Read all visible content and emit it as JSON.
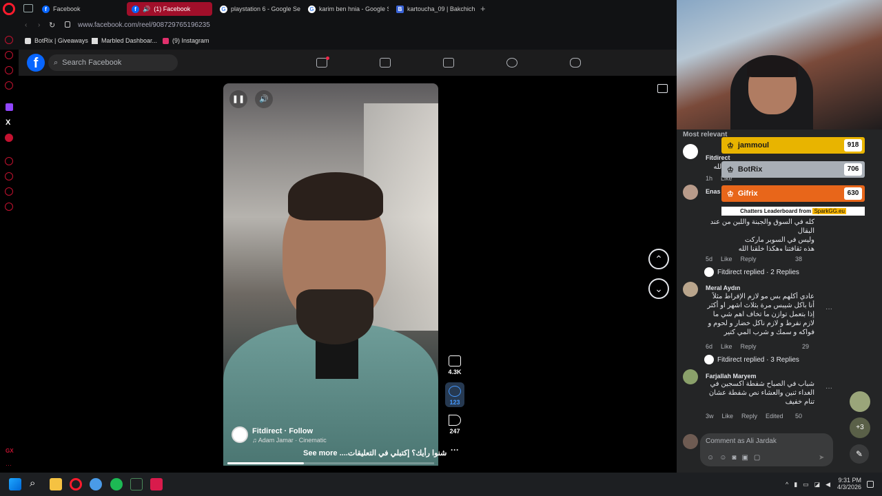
{
  "browser": {
    "tabs": [
      {
        "label": "Facebook",
        "active": false
      },
      {
        "label": "(1) Facebook",
        "active": true
      },
      {
        "label": "playstation 6 - Google Se",
        "active": false
      },
      {
        "label": "karim ben hnia - Google S",
        "active": false
      },
      {
        "label": "kartoucha_09 | Bakchich p",
        "active": false
      }
    ],
    "new_tab_label": "+",
    "url": "www.facebook.com/reel/908729765196235",
    "bookmarks": [
      "BotRix | Giveaways",
      "Marbled Dashboar...",
      "(9) Instagram"
    ]
  },
  "facebook": {
    "logo": "f",
    "search_placeholder": "Search Facebook",
    "nav": [
      "home-icon",
      "video-icon",
      "marketplace-icon",
      "groups-icon",
      "gaming-icon"
    ]
  },
  "reel": {
    "poster_name": "Fitdirect",
    "follow_label": "Follow",
    "audio": "Adam Jamar · Cinematic",
    "caption": "شنوا رأيك؟ إكتبلي في التعليقات....",
    "see_more": "See more",
    "likes": "4.3K",
    "comments": "123",
    "shares": "247",
    "more": "···",
    "progress": 0.37
  },
  "comments_panel": {
    "sort_label": "Most relevant",
    "leaderboard": [
      {
        "name": "jammoul",
        "score": "918",
        "color": "#e8b400"
      },
      {
        "name": "BotRix",
        "score": "706",
        "color": "#a9afb6"
      },
      {
        "name": "Gifrix",
        "score": "630",
        "color": "#e8661a"
      }
    ],
    "leaderboard_caption": "Chatters Leaderboard from",
    "leaderboard_brand": "SparkGG.eu",
    "items": [
      {
        "name": "Fitdirect",
        "text": "عد الله",
        "time": "1h",
        "like": "Like"
      },
      {
        "name": "Enas",
        "text": "كله في السوق والجبنة واللبن من عند البقال\nوليس في السوبر ماركت\nهذه ثقافتنا وهكذا خلقنا الله",
        "time": "5d",
        "like": "Like",
        "reply": "Reply",
        "count": "38"
      },
      {
        "name": "Meral Aydın",
        "text": "عادي أكلهم بس مو لازم الإفراط مثلاً أنا باكل شيبس مرة بثلاث اشهر او أكثر إذا بتعمل توازن ما تخاف اهم شي ما لازم نفرط و لازم ناكل خضار و لحوم و فواكه و سمك و شرب المي كتير",
        "time": "6d",
        "like": "Like",
        "reply": "Reply",
        "count": "29"
      },
      {
        "name": "Farjallah Maryem",
        "text": "شباب في الصباح شفطة اكسجين في الغداء ثنين والعشاء نص شفطة عشان تنام خفيف",
        "time": "3w",
        "like": "Like",
        "reply": "Reply",
        "edited": "Edited",
        "count": "50"
      }
    ],
    "replied_1": "Fitdirect replied · 2 Replies",
    "replied_2": "Fitdirect replied · 3 Replies",
    "comment_placeholder": "Comment as Ali Jardak",
    "side_badge": "+3"
  },
  "taskbar": {
    "time": "9:31 PM",
    "date": "4/3/2026"
  }
}
